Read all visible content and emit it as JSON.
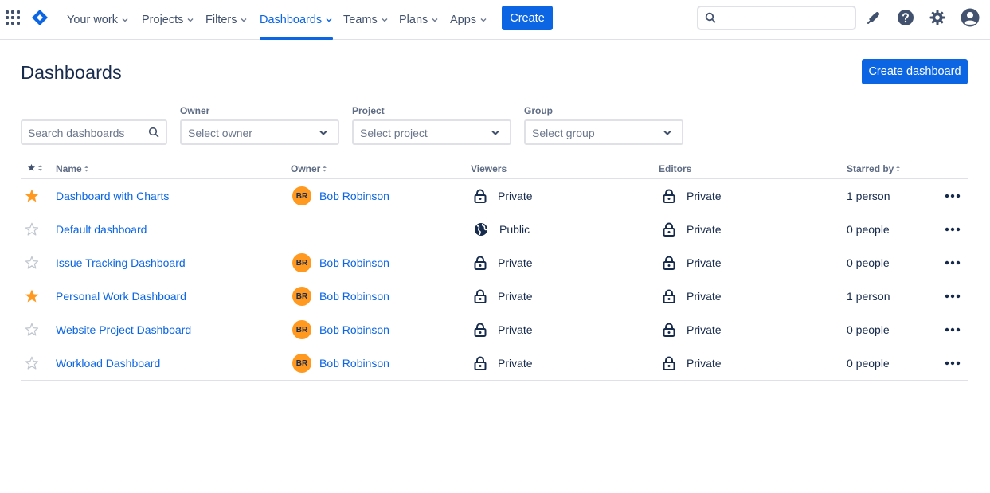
{
  "nav": {
    "items": [
      {
        "label": "Your work"
      },
      {
        "label": "Projects"
      },
      {
        "label": "Filters"
      },
      {
        "label": "Dashboards"
      },
      {
        "label": "Teams"
      },
      {
        "label": "Plans"
      },
      {
        "label": "Apps"
      }
    ],
    "active_item": "Dashboards",
    "create_label": "Create",
    "search_placeholder": "",
    "icons": [
      "app-switcher-icon",
      "jira-logo",
      "search-icon",
      "notifications-icon",
      "help-icon",
      "settings-icon",
      "profile-icon"
    ]
  },
  "page": {
    "title": "Dashboards",
    "create_dashboard_label": "Create dashboard"
  },
  "filters": {
    "search_placeholder": "Search dashboards",
    "owner": {
      "label": "Owner",
      "placeholder": "Select owner"
    },
    "project": {
      "label": "Project",
      "placeholder": "Select project"
    },
    "group": {
      "label": "Group",
      "placeholder": "Select group"
    }
  },
  "table": {
    "columns": {
      "name": "Name",
      "owner": "Owner",
      "viewers": "Viewers",
      "editors": "Editors",
      "starred_by": "Starred by"
    },
    "rows": [
      {
        "starred": true,
        "name": "Dashboard with Charts",
        "owner_initials": "BR",
        "owner": "Bob Robinson",
        "viewers": "Private",
        "viewers_icon": "lock-icon",
        "editors": "Private",
        "starred_by": "1 person"
      },
      {
        "starred": false,
        "name": "Default dashboard",
        "owner_initials": "",
        "owner": "",
        "viewers": "Public",
        "viewers_icon": "globe-icon",
        "editors": "Private",
        "starred_by": "0 people"
      },
      {
        "starred": false,
        "name": "Issue Tracking Dashboard",
        "owner_initials": "BR",
        "owner": "Bob Robinson",
        "viewers": "Private",
        "viewers_icon": "lock-icon",
        "editors": "Private",
        "starred_by": "0 people"
      },
      {
        "starred": true,
        "name": "Personal Work Dashboard",
        "owner_initials": "BR",
        "owner": "Bob Robinson",
        "viewers": "Private",
        "viewers_icon": "lock-icon",
        "editors": "Private",
        "starred_by": "1 person"
      },
      {
        "starred": false,
        "name": "Website Project Dashboard",
        "owner_initials": "BR",
        "owner": "Bob Robinson",
        "viewers": "Private",
        "viewers_icon": "lock-icon",
        "editors": "Private",
        "starred_by": "0 people"
      },
      {
        "starred": false,
        "name": "Workload Dashboard",
        "owner_initials": "BR",
        "owner": "Bob Robinson",
        "viewers": "Private",
        "viewers_icon": "lock-icon",
        "editors": "Private",
        "starred_by": "0 people"
      }
    ]
  },
  "colors": {
    "accent": "#0c66e4",
    "star_on": "#ff991f",
    "avatar": "#ff991f",
    "text": "#172b4d",
    "muted": "#5e6c84",
    "border": "#dfe1e6"
  }
}
